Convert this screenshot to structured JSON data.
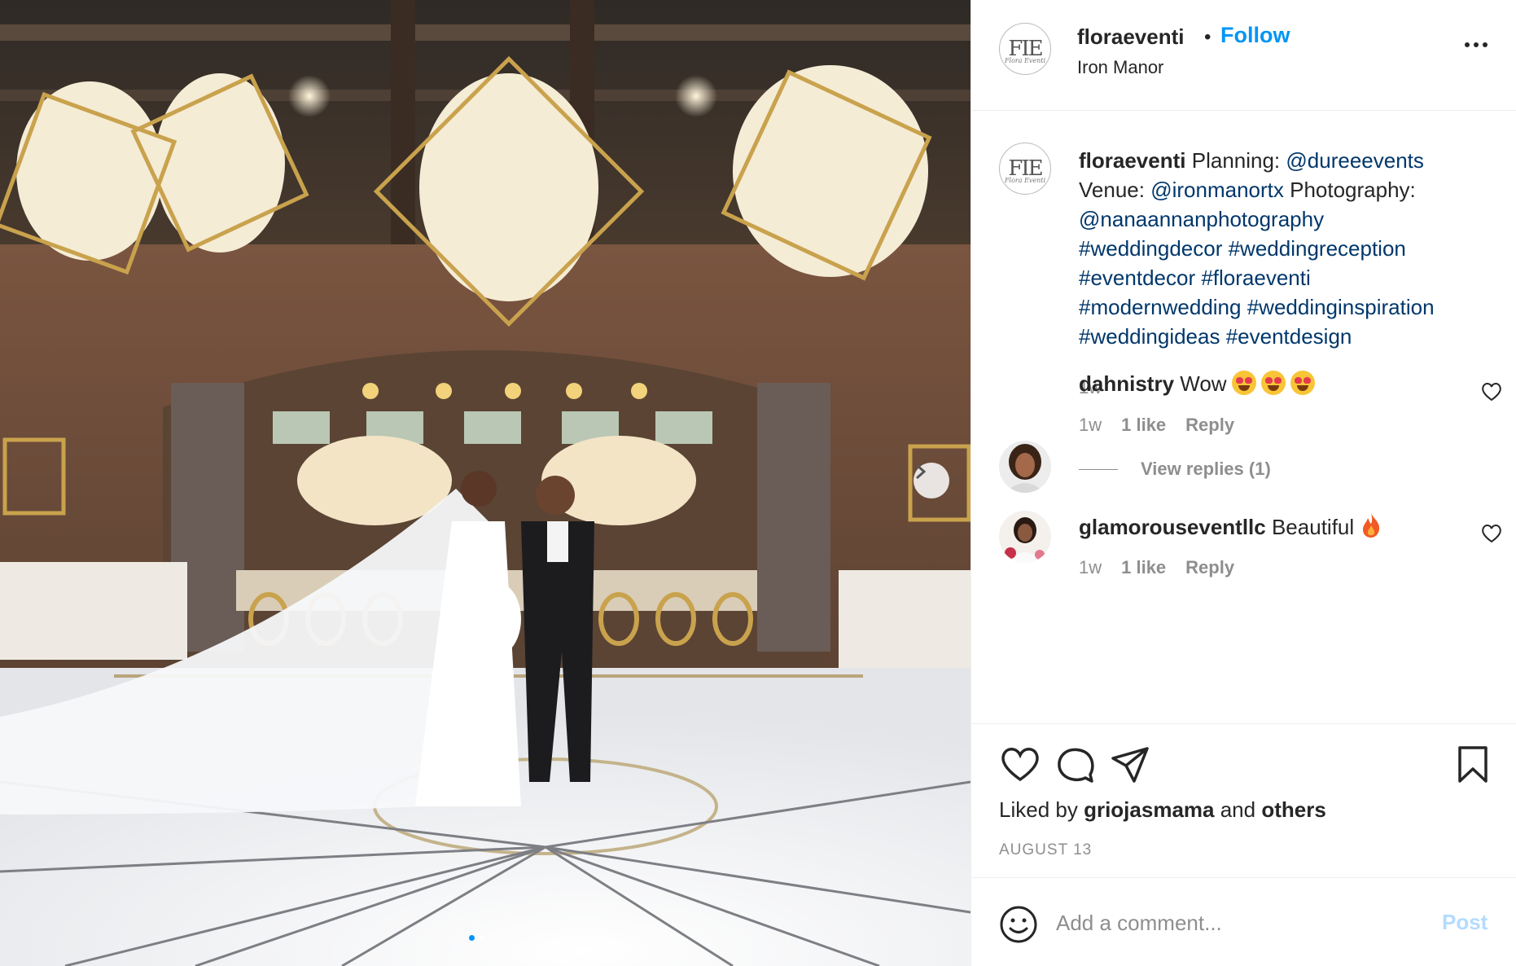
{
  "post": {
    "username": "floraeventi",
    "follow_label": "Follow",
    "separator": "•",
    "location": "Iron Manor",
    "avatar_logo": "FIE",
    "avatar_logo_sub": "Flora Eventi"
  },
  "caption": {
    "username": "floraeventi",
    "parts": {
      "p1": "Planning: ",
      "m1": "@dureeevents",
      "p2": "Venue: ",
      "m2": "@ironmanortx",
      "p3": " Photography: ",
      "m3": "@nanaannanphotography",
      "h1": "#weddingdecor",
      "h2": "#weddingreception",
      "h3": "#eventdecor",
      "h4": "#floraeventi",
      "h5": "#modernwedding",
      "h6": "#weddinginspiration",
      "h7": "#weddingideas",
      "h8": "#eventdesign"
    },
    "time": "1w"
  },
  "comments": [
    {
      "username": "dahnistry",
      "text": "Wow",
      "emoji": [
        "heart-eyes-emoji",
        "heart-eyes-emoji",
        "heart-eyes-emoji"
      ],
      "time": "1w",
      "likes": "1 like",
      "reply_label": "Reply",
      "view_replies": "View replies (1)"
    },
    {
      "username": "glamorouseventllc",
      "text": "Beautiful",
      "emoji": [
        "fire-emoji"
      ],
      "time": "1w",
      "likes": "1 like",
      "reply_label": "Reply"
    }
  ],
  "actions": {
    "icons": [
      "heart-icon",
      "comment-icon",
      "share-icon",
      "bookmark-icon"
    ],
    "liked_prefix": "Liked by ",
    "liked_user": "griojasmama",
    "liked_mid": " and ",
    "liked_others": "others",
    "date": "AUGUST 13"
  },
  "add_comment": {
    "placeholder": "Add a comment...",
    "post_label": "Post"
  },
  "carousel": {
    "slides": 2,
    "active_slide": 1
  },
  "colors": {
    "link": "#00376b",
    "follow": "#0095f6",
    "muted": "#8e8e8e",
    "post_disabled": "#b3dbff"
  }
}
